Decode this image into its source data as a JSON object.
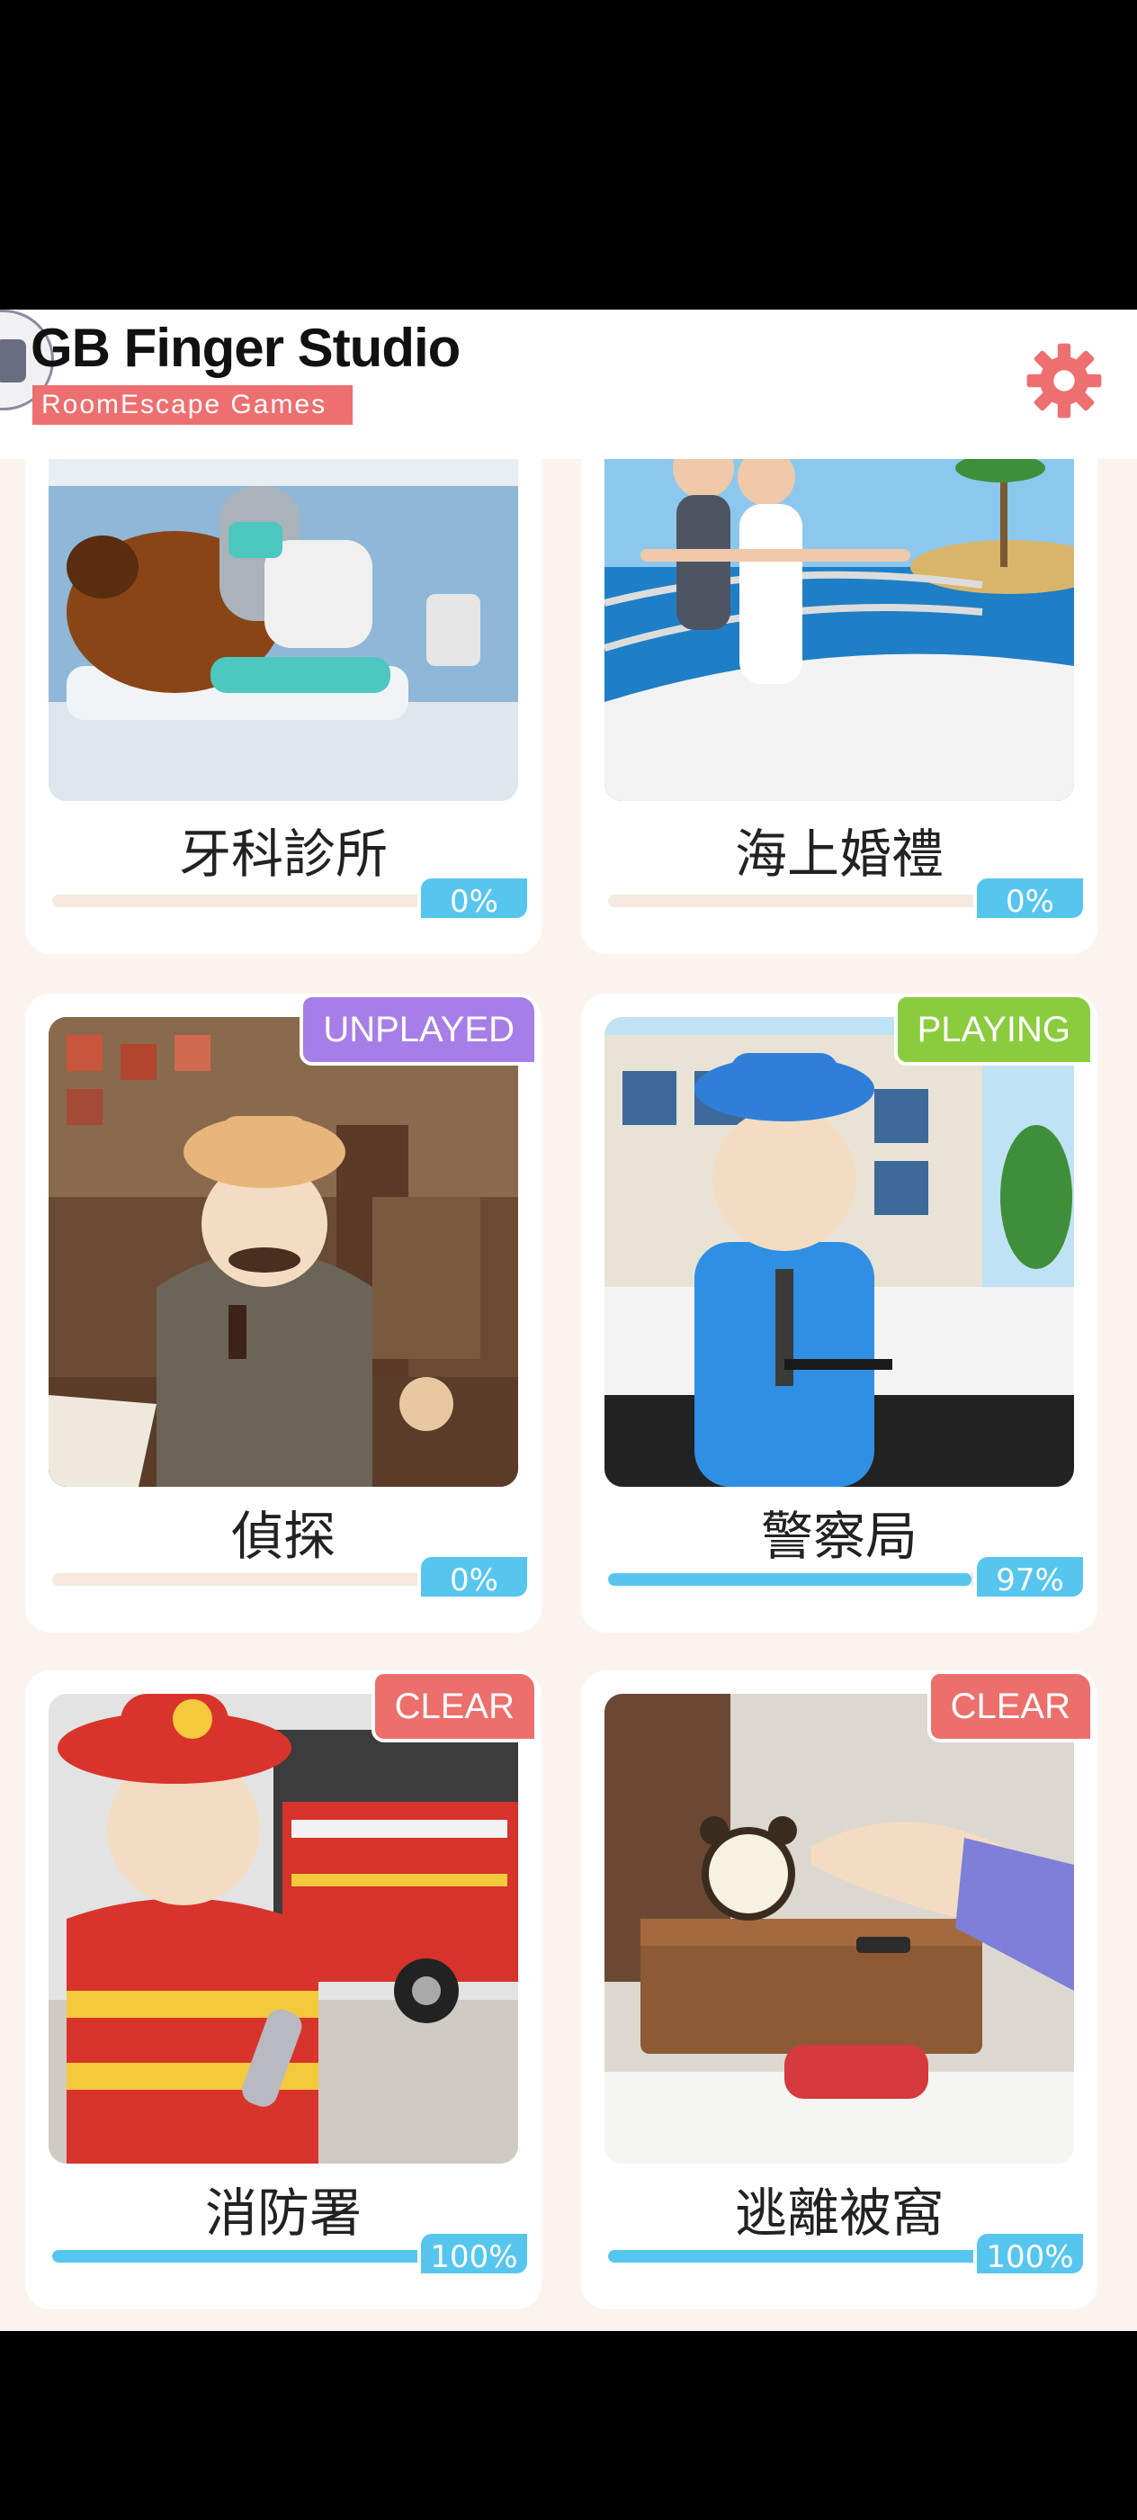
{
  "header": {
    "title": "GB Finger Studio",
    "subtitle": "RoomEscape Games",
    "settings_icon": "gear-icon",
    "accent": "#ee6f6f"
  },
  "games": [
    {
      "title": "牙科診所",
      "progress_label": "0%",
      "progress": 0,
      "badge": ""
    },
    {
      "title": "海上婚禮",
      "progress_label": "0%",
      "progress": 0,
      "badge": ""
    },
    {
      "title": "偵探",
      "progress_label": "0%",
      "progress": 0,
      "badge": "UNPLAYED"
    },
    {
      "title": "警察局",
      "progress_label": "97%",
      "progress": 0.97,
      "badge": "PLAYING"
    },
    {
      "title": "消防署",
      "progress_label": "100%",
      "progress": 1,
      "badge": "CLEAR"
    },
    {
      "title": "逃離被窩",
      "progress_label": "100%",
      "progress": 1,
      "badge": "CLEAR"
    }
  ],
  "colors": {
    "progress": "#57c6ee",
    "unplayed": "#a77ee8",
    "playing": "#8bcc3e",
    "clear": "#ec6f6c"
  }
}
